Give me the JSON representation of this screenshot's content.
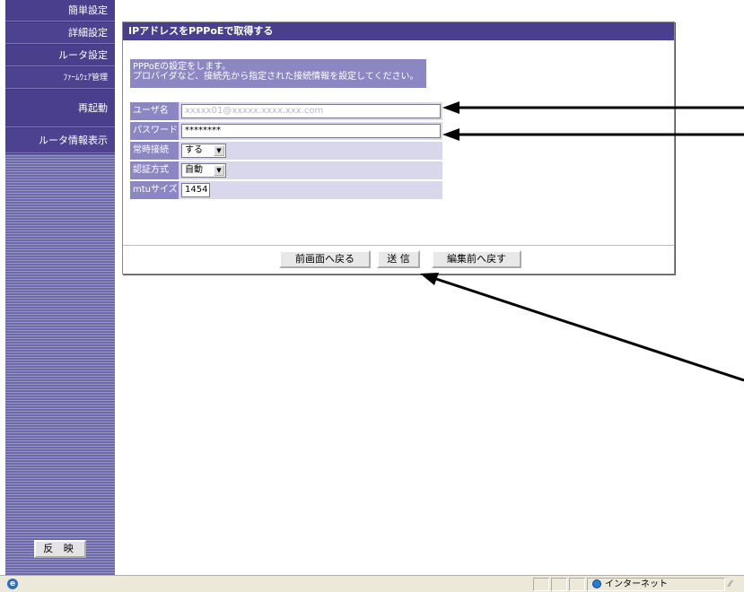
{
  "sidebar": {
    "items": [
      {
        "label": "簡単設定"
      },
      {
        "label": "詳細設定"
      },
      {
        "label": "ルータ設定"
      },
      {
        "label": "ﾌｧｰﾑｳｪｱ管理"
      },
      {
        "label": "再起動"
      },
      {
        "label": "ルータ情報表示"
      }
    ],
    "apply_label": "反 映"
  },
  "panel": {
    "title": "IPアドレスをPPPoEで取得する",
    "description_line1": "PPPoEの設定をします。",
    "description_line2": "プロバイダなど、接続先から指定された接続情報を設定してください。",
    "fields": {
      "username_label": "ユーザ名",
      "username_value": "xxxxx01@xxxxx.xxxx.xxx.com",
      "password_label": "パスワード",
      "password_value": "********",
      "always_connect_label": "常時接続",
      "always_connect_value": "する",
      "auth_label": "認証方式",
      "auth_value": "自動",
      "mtu_label": "mtuサイズ",
      "mtu_value": "1454"
    },
    "buttons": {
      "back_label": "前画面へ戻る",
      "send_label": "送 信",
      "revert_label": "編集前へ戻す"
    }
  },
  "statusbar": {
    "zone": "インターネット"
  },
  "colors": {
    "menu_bg": "#4a3f8c",
    "label_bg": "#8c86c2",
    "row_bg": "#d9d7ec"
  }
}
